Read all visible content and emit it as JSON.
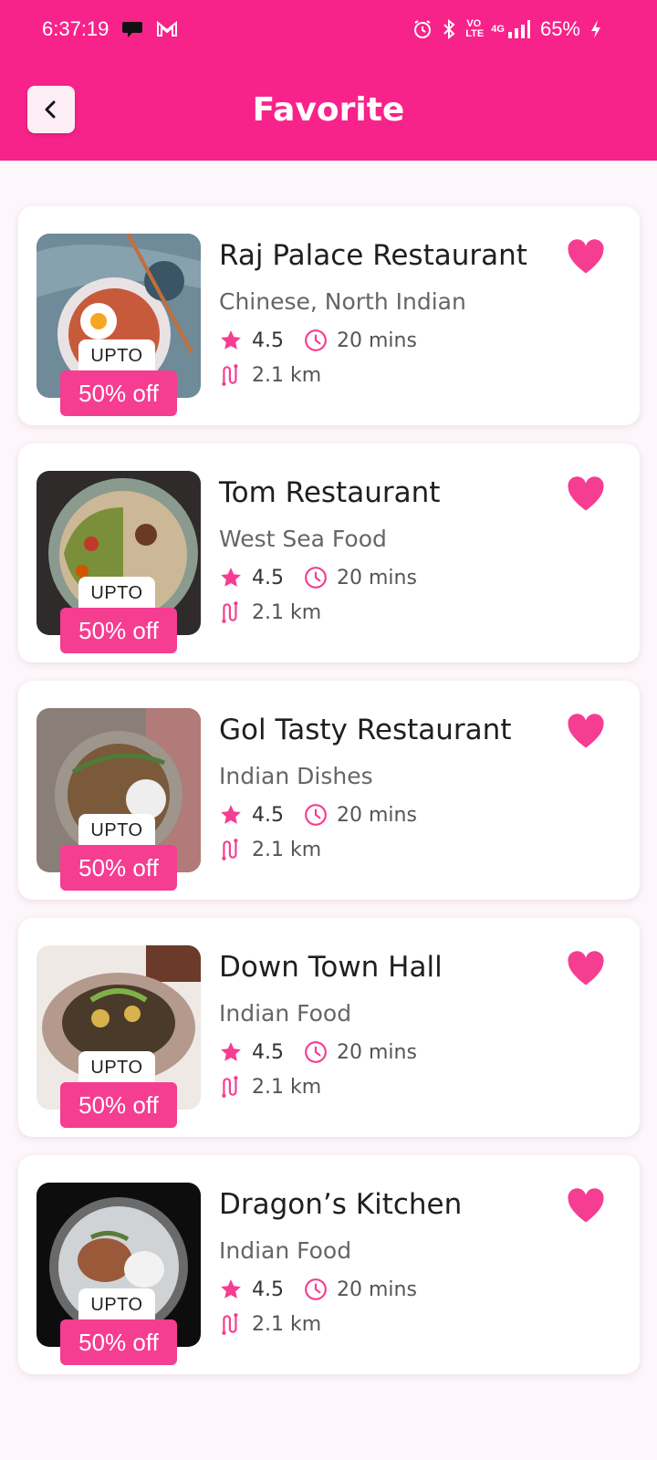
{
  "status_bar": {
    "time": "6:37:19",
    "battery": "65%",
    "network": "4G",
    "volte": "VO LTE",
    "icons": [
      "chat-icon",
      "gmail-icon",
      "alarm-icon",
      "bluetooth-icon",
      "volte-icon",
      "signal-icon",
      "battery-charging-icon"
    ]
  },
  "header": {
    "title": "Favorite",
    "back_icon": "chevron-left-icon"
  },
  "colors": {
    "primary": "#f7238a",
    "accent": "#f53d92",
    "background": "#fdf6fa"
  },
  "restaurants": [
    {
      "name": "Raj Palace Restaurant",
      "cuisine": "Chinese, North Indian",
      "rating": "4.5",
      "time": "20 mins",
      "distance": "2.1 km",
      "upto": "UPTO",
      "offer": "50% off",
      "favorite": true
    },
    {
      "name": "Tom Restaurant",
      "cuisine": "West Sea Food",
      "rating": "4.5",
      "time": "20 mins",
      "distance": "2.1 km",
      "upto": "UPTO",
      "offer": "50% off",
      "favorite": true
    },
    {
      "name": "Gol Tasty Restaurant",
      "cuisine": "Indian Dishes",
      "rating": "4.5",
      "time": "20 mins",
      "distance": "2.1 km",
      "upto": "UPTO",
      "offer": "50% off",
      "favorite": true
    },
    {
      "name": "Down Town Hall",
      "cuisine": "Indian Food",
      "rating": "4.5",
      "time": "20 mins",
      "distance": "2.1 km",
      "upto": "UPTO",
      "offer": "50% off",
      "favorite": true
    },
    {
      "name": "Dragon’s Kitchen",
      "cuisine": "Indian Food",
      "rating": "4.5",
      "time": "20 mins",
      "distance": "2.1 km",
      "upto": "UPTO",
      "offer": "50% off",
      "favorite": true
    }
  ]
}
